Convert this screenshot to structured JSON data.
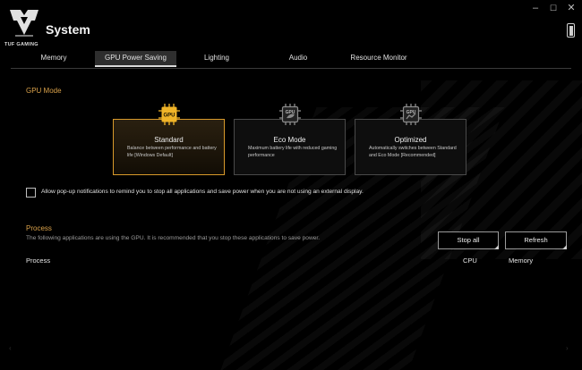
{
  "app": {
    "logo_text": "TUF GAMING",
    "title": "System",
    "window_controls": {
      "minimize": "–",
      "maximize": "☐",
      "close": "✕"
    }
  },
  "tabs": [
    {
      "label": "Memory",
      "active": false
    },
    {
      "label": "GPU Power Saving",
      "active": true
    },
    {
      "label": "Lighting",
      "active": false
    },
    {
      "label": "Audio",
      "active": false
    },
    {
      "label": "Resource Monitor",
      "active": false
    }
  ],
  "gpu_mode": {
    "heading": "GPU Mode",
    "modes": [
      {
        "icon_label": "GPU",
        "name": "Standard",
        "description": "Balance between performance and battery life [Windows Default]",
        "selected": true
      },
      {
        "icon_label": "GPU",
        "name": "Eco Mode",
        "description": "Maximum battery life with reduced gaming performance",
        "selected": false
      },
      {
        "icon_label": "GPU",
        "name": "Optimized",
        "description": "Automatically switches between Standard and Eco Mode [Recommended]",
        "selected": false
      }
    ]
  },
  "notification": {
    "checked": false,
    "label": "Allow pop-up notifications to remind you to stop all applications and save power when you are not using an external display."
  },
  "process": {
    "heading": "Process",
    "description": "The following applications are using the GPU. It is recommended that you stop these applications to save power.",
    "stop_all_label": "Stop all",
    "refresh_label": "Refresh",
    "columns": {
      "process": "Process",
      "cpu": "CPU",
      "memory": "Memory"
    },
    "rows": []
  },
  "colors": {
    "accent": "#d9a14a",
    "selected_border": "#d99a2b",
    "background": "#000000"
  }
}
